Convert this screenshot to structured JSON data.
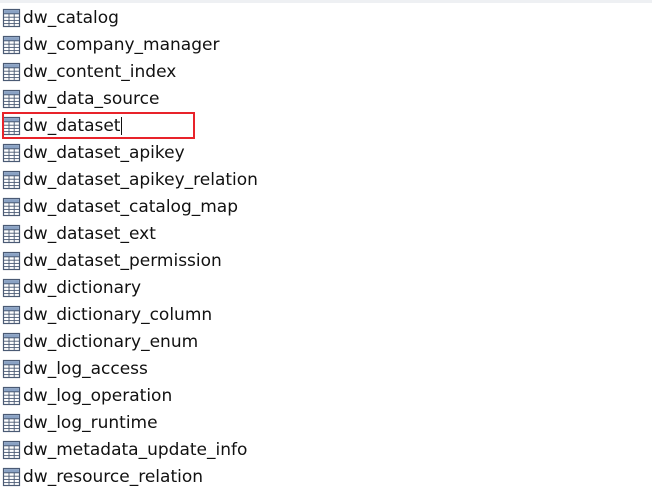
{
  "tables": [
    {
      "name": "dw_catalog",
      "icon": "table-icon"
    },
    {
      "name": "dw_company_manager",
      "icon": "table-icon"
    },
    {
      "name": "dw_content_index",
      "icon": "table-icon"
    },
    {
      "name": "dw_data_source",
      "icon": "table-icon"
    },
    {
      "name": "dw_dataset",
      "icon": "table-icon",
      "selected": true,
      "highlighted": true
    },
    {
      "name": "dw_dataset_apikey",
      "icon": "table-icon"
    },
    {
      "name": "dw_dataset_apikey_relation",
      "icon": "table-icon"
    },
    {
      "name": "dw_dataset_catalog_map",
      "icon": "table-icon"
    },
    {
      "name": "dw_dataset_ext",
      "icon": "table-icon"
    },
    {
      "name": "dw_dataset_permission",
      "icon": "table-icon"
    },
    {
      "name": "dw_dictionary",
      "icon": "table-icon"
    },
    {
      "name": "dw_dictionary_column",
      "icon": "table-icon"
    },
    {
      "name": "dw_dictionary_enum",
      "icon": "table-icon"
    },
    {
      "name": "dw_log_access",
      "icon": "table-icon"
    },
    {
      "name": "dw_log_operation",
      "icon": "table-icon"
    },
    {
      "name": "dw_log_runtime",
      "icon": "table-icon"
    },
    {
      "name": "dw_metadata_update_info",
      "icon": "table-icon"
    },
    {
      "name": "dw_resource_relation",
      "icon": "table-icon"
    }
  ],
  "colors": {
    "highlight_border": "#e8232a",
    "icon_stroke": "#4a5a74",
    "icon_header": "#8aa2c4"
  }
}
